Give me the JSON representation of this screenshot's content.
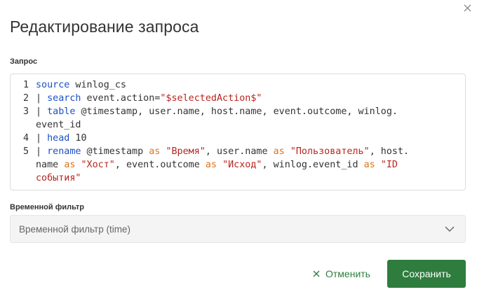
{
  "dialog": {
    "title": "Редактирование запроса",
    "close_icon": "close-icon"
  },
  "query": {
    "label": "Запрос",
    "lines": [
      {
        "num": "1",
        "parts": [
          {
            "t": "source",
            "c": "kw"
          },
          {
            "t": " winlog_cs",
            "c": ""
          }
        ]
      },
      {
        "num": "2",
        "parts": [
          {
            "t": "| ",
            "c": ""
          },
          {
            "t": "search",
            "c": "kw"
          },
          {
            "t": " event.action=",
            "c": ""
          },
          {
            "t": "\"$selectedAction$\"",
            "c": "str"
          }
        ]
      },
      {
        "num": "3",
        "parts": [
          {
            "t": "| ",
            "c": ""
          },
          {
            "t": "table",
            "c": "kw"
          },
          {
            "t": " @timestamp, user.name, host.name, event.outcome, winlog.",
            "c": ""
          }
        ]
      },
      {
        "num": "",
        "parts": [
          {
            "t": "event_id",
            "c": ""
          }
        ]
      },
      {
        "num": "4",
        "parts": [
          {
            "t": "| ",
            "c": ""
          },
          {
            "t": "head",
            "c": "kw"
          },
          {
            "t": " 10",
            "c": ""
          }
        ]
      },
      {
        "num": "5",
        "parts": [
          {
            "t": "| ",
            "c": ""
          },
          {
            "t": "rename",
            "c": "kw"
          },
          {
            "t": " @timestamp ",
            "c": ""
          },
          {
            "t": "as",
            "c": "op"
          },
          {
            "t": " ",
            "c": ""
          },
          {
            "t": "\"Время\"",
            "c": "str"
          },
          {
            "t": ", user.name ",
            "c": ""
          },
          {
            "t": "as",
            "c": "op"
          },
          {
            "t": " ",
            "c": ""
          },
          {
            "t": "\"Пользователь\"",
            "c": "str"
          },
          {
            "t": ", host.",
            "c": ""
          }
        ]
      },
      {
        "num": "",
        "parts": [
          {
            "t": "name ",
            "c": ""
          },
          {
            "t": "as",
            "c": "op"
          },
          {
            "t": " ",
            "c": ""
          },
          {
            "t": "\"Хост\"",
            "c": "str"
          },
          {
            "t": ", event.outcome ",
            "c": ""
          },
          {
            "t": "as",
            "c": "op"
          },
          {
            "t": " ",
            "c": ""
          },
          {
            "t": "\"Исход\"",
            "c": "str"
          },
          {
            "t": ", winlog.event_id ",
            "c": ""
          },
          {
            "t": "as",
            "c": "op"
          },
          {
            "t": " ",
            "c": ""
          },
          {
            "t": "\"ID",
            "c": "str"
          }
        ]
      },
      {
        "num": "",
        "parts": [
          {
            "t": "события\"",
            "c": "str"
          }
        ]
      }
    ]
  },
  "time_filter": {
    "label": "Временной фильтр",
    "selected": "Временной фильтр (time)",
    "icon": "chevron-down-icon"
  },
  "actions": {
    "cancel_label": "Отменить",
    "cancel_icon": "close-icon",
    "save_label": "Сохранить"
  },
  "colors": {
    "accent": "#2e7d3e",
    "keyword": "#1b4fc4",
    "string": "#b8261f",
    "operator": "#e0721a"
  }
}
